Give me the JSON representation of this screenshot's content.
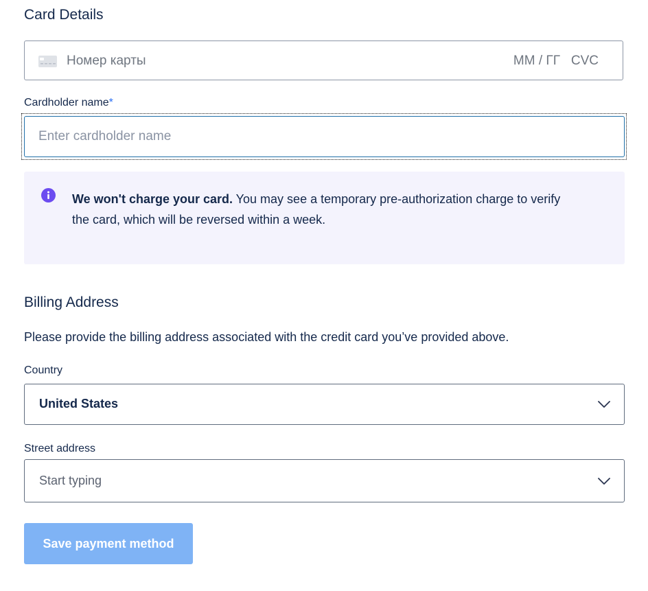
{
  "card_details": {
    "title": "Card Details",
    "card_number_placeholder": "Номер карты",
    "expiry_placeholder": "ММ / ГГ",
    "cvc_placeholder": "CVC"
  },
  "cardholder": {
    "label": "Cardholder name",
    "required_marker": "*",
    "placeholder": "Enter cardholder name",
    "value": ""
  },
  "notice": {
    "bold": "We won't charge your card.",
    "text": " You may see a temporary pre-authorization charge to verify the card, which will be reversed within a week."
  },
  "billing": {
    "title": "Billing Address",
    "description": "Please provide the billing address associated with the credit card you’ve provided above.",
    "country_label": "Country",
    "country_value": "United States",
    "street_label": "Street address",
    "street_placeholder": "Start typing"
  },
  "actions": {
    "save_label": "Save payment method"
  },
  "colors": {
    "accent": "#2a6ff3",
    "button_disabled": "#7fb3f5",
    "info_background": "#f4f3fd",
    "info_icon": "#6c4cf0"
  },
  "icons": [
    "card-icon",
    "info-icon",
    "chevron-down-icon"
  ]
}
